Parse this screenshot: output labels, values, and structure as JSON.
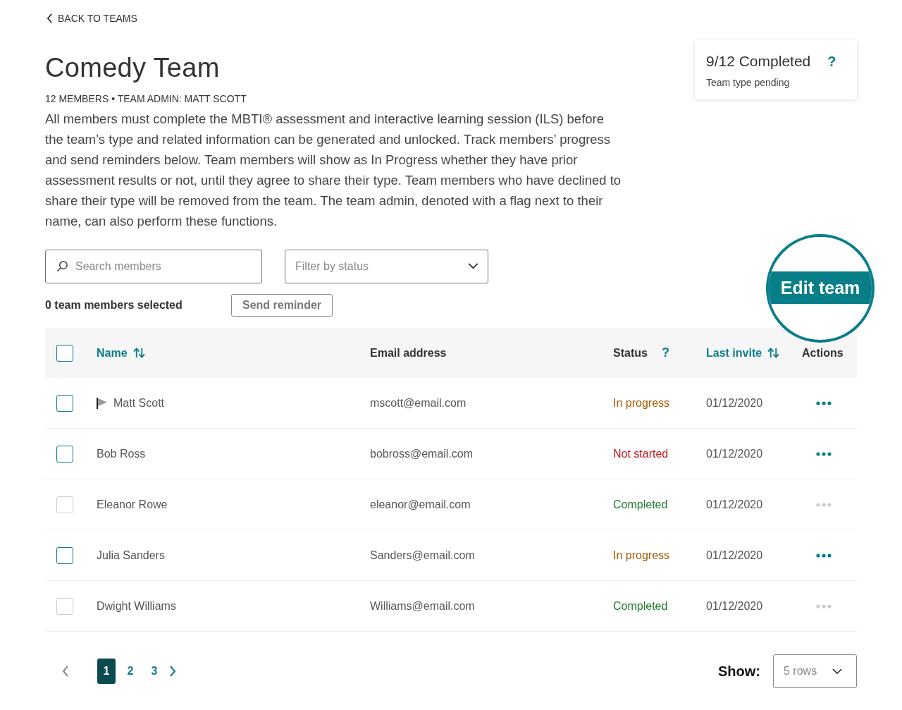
{
  "back_link": "BACK TO TEAMS",
  "title": "Comedy Team",
  "subtitle": "12 MEMBERS • TEAM ADMIN: MATT SCOTT",
  "description": "All members must complete the MBTI® assessment and interactive learning session (ILS) before the team’s type and related information can be generated and unlocked. Track members’ progress and send reminders below. Team members will show as In Progress whether they have prior assessment results or not, until they agree to share their type. Team members who have declined to share their type will be removed from the team. The team admin, denoted with a flag next to their name, can also perform these functions.",
  "progress_card": {
    "title": "9/12 Completed",
    "help": "?",
    "subtitle": "Team type pending"
  },
  "search": {
    "placeholder": "Search members"
  },
  "filter": {
    "placeholder": "Filter by status"
  },
  "selection_count": "0 team members selected",
  "send_reminder": "Send reminder",
  "edit_team": "Edit team",
  "table": {
    "all_checked": false,
    "columns": [
      {
        "label": "Name",
        "sortable": true
      },
      {
        "label": "Email address",
        "sortable": false
      },
      {
        "label": "Status",
        "sortable": false,
        "help": "?"
      },
      {
        "label": "Last invite",
        "sortable": true
      },
      {
        "label": "Actions",
        "sortable": false
      }
    ],
    "rows": [
      {
        "name": "Matt Scott",
        "admin": true,
        "email": "mscott@email.com",
        "status": "In progress",
        "kind": "in_progress",
        "last_invite": "01/12/2020",
        "disabled": false,
        "checked": false
      },
      {
        "name": "Bob Ross",
        "admin": false,
        "email": "bobross@email.com",
        "status": "Not started",
        "kind": "not_started",
        "last_invite": "01/12/2020",
        "disabled": false,
        "checked": false
      },
      {
        "name": "Eleanor Rowe",
        "admin": false,
        "email": "eleanor@email.com",
        "status": "Completed",
        "kind": "completed",
        "last_invite": "01/12/2020",
        "disabled": true,
        "checked": false
      },
      {
        "name": "Julia Sanders",
        "admin": false,
        "email": "Sanders@email.com",
        "status": "In progress",
        "kind": "in_progress",
        "last_invite": "01/12/2020",
        "disabled": false,
        "checked": false
      },
      {
        "name": "Dwight Williams",
        "admin": false,
        "email": "Williams@email.com",
        "status": "Completed",
        "kind": "completed",
        "last_invite": "01/12/2020",
        "disabled": true,
        "checked": false
      }
    ]
  },
  "pagination": {
    "pages": [
      {
        "label": "1",
        "selected": true
      },
      {
        "label": "2",
        "selected": false
      },
      {
        "label": "3",
        "selected": false
      }
    ]
  },
  "rows_per_page": {
    "label": "Show:",
    "value": "5 rows"
  }
}
